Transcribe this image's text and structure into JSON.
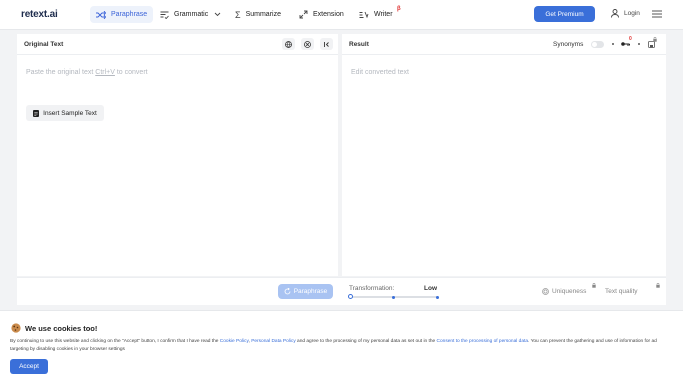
{
  "app": {
    "logo": "retext.ai"
  },
  "nav": {
    "paraphrase": "Paraphrase",
    "grammatic": "Grammatic",
    "summarize": "Summarize",
    "extension": "Extension",
    "writer": "Writer",
    "writer_badge": "β"
  },
  "header": {
    "premium": "Get Premium",
    "login": "Login"
  },
  "left_panel": {
    "title": "Original Text",
    "placeholder_pre": "Paste the original text ",
    "placeholder_shortcut": "Ctrl+V",
    "placeholder_post": " to convert",
    "sample_button": "Insert Sample Text"
  },
  "right_panel": {
    "title": "Result",
    "synonyms": "Synonyms",
    "placeholder": "Edit converted text",
    "badge": "0"
  },
  "bottom": {
    "paraphrase_button": "Paraphrase",
    "transformation_label": "Transformation:",
    "transformation_value": "Low",
    "transformation_level": 0,
    "uniqueness": "Uniqueness",
    "text_quality": "Text quality"
  },
  "cookie": {
    "title": "We use cookies too!",
    "text_1": "By continuing to use this website and clicking on the \"Accept\" button, I confirm that I have read the ",
    "link_1": "Cookie Policy",
    "sep_1": ", ",
    "link_2": "Personal Data Policy",
    "text_2": " and agree to the processing of my personal data as set out in the ",
    "link_3": "Consent to the processing of personal data",
    "text_3": ". You can prevent the gathering and use of information for ad targeting by disabling cookies in your browser settings",
    "accept": "Accept"
  },
  "colors": {
    "accent": "#3a6fd9",
    "accent_light": "#a9c3f2",
    "badge_red": "#e03434"
  }
}
